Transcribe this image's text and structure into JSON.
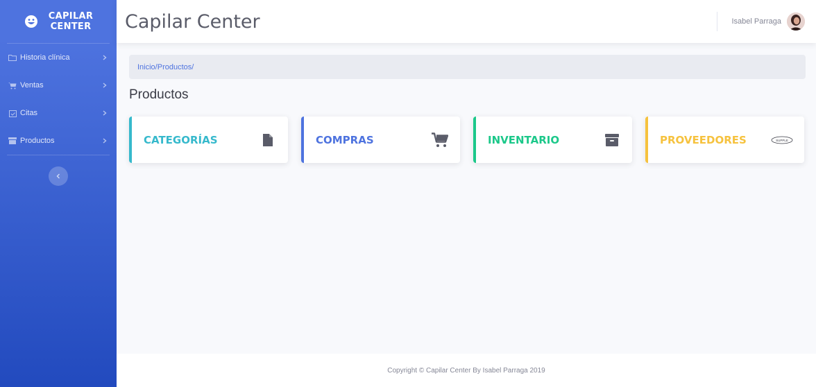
{
  "brand": {
    "line1": "CAPILAR",
    "line2": "CENTER",
    "icon": "laugh-icon"
  },
  "sidebar": {
    "items": [
      {
        "label": "Historia clínica",
        "icon": "folder-icon"
      },
      {
        "label": "Ventas",
        "icon": "cart-icon"
      },
      {
        "label": "Citas",
        "icon": "calendar-check-icon"
      },
      {
        "label": "Productos",
        "icon": "box-icon"
      }
    ],
    "toggle_icon": "chevron-left-icon"
  },
  "topbar": {
    "title": "Capilar Center",
    "user_name": "Isabel Parraga"
  },
  "breadcrumb": {
    "text": "Inicio/Productos/"
  },
  "page": {
    "heading": "Productos"
  },
  "cards": [
    {
      "label": "CATEGORÍAS",
      "color": "#36b9cc",
      "icon": "file-icon"
    },
    {
      "label": "COMPRAS",
      "color": "#4e73df",
      "icon": "shopping-cart-icon"
    },
    {
      "label": "INVENTARIO",
      "color": "#1cc88a",
      "icon": "archive-icon"
    },
    {
      "label": "PROVEEDORES",
      "color": "#f6c23e",
      "icon": "supplier-logo-icon",
      "logo_text": "SUPPLE"
    }
  ],
  "footer": {
    "text": "Copyright © Capilar Center By Isabel Parraga 2019"
  },
  "colors": {
    "primary": "#4e73df",
    "primary_dark": "#224abe",
    "icon_gray": "#5a5c69"
  }
}
